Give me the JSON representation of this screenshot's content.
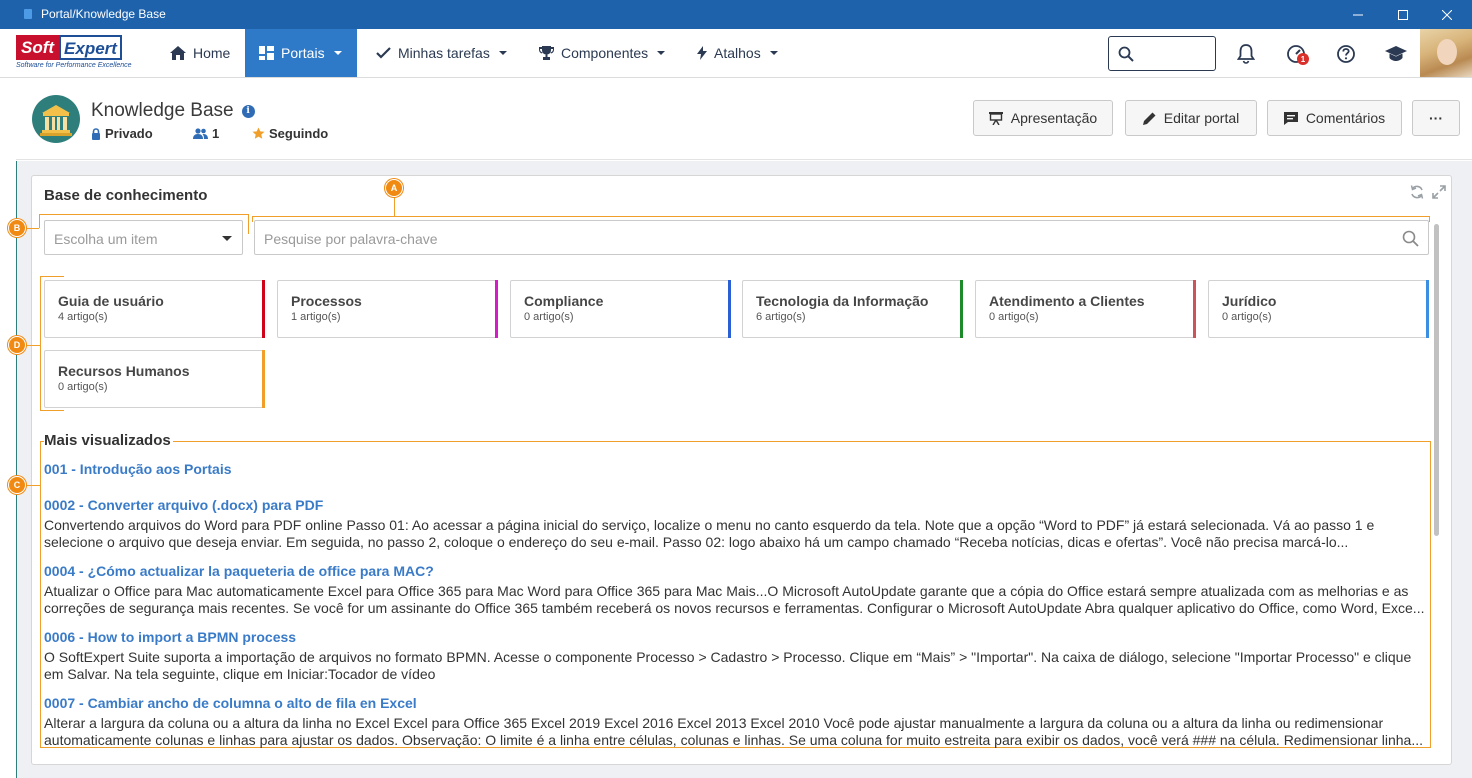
{
  "window": {
    "title": "Portal/Knowledge Base"
  },
  "brand": {
    "logo_left": "Soft",
    "logo_right": "Expert",
    "tagline": "Software for Performance Excellence",
    "accent": "#2f7ac8",
    "titlebar": "#1e62ac"
  },
  "nav": {
    "items": [
      {
        "label": "Home",
        "icon": "home-icon"
      },
      {
        "label": "Portais",
        "icon": "dashboard-icon"
      },
      {
        "label": "Minhas tarefas",
        "icon": "check-icon"
      },
      {
        "label": "Componentes",
        "icon": "trophy-icon"
      },
      {
        "label": "Atalhos",
        "icon": "bolt-icon"
      }
    ],
    "notification_count": "1"
  },
  "header": {
    "title": "Knowledge Base",
    "privacy": "Privado",
    "members": "1",
    "following": "Seguindo",
    "buttons": {
      "presentation": "Apresentação",
      "edit": "Editar portal",
      "comments": "Comentários",
      "more": "···"
    }
  },
  "panel": {
    "title": "Base de conhecimento",
    "select_placeholder": "Escolha um item",
    "search_placeholder": "Pesquise por palavra-chave"
  },
  "categories": [
    {
      "name": "Guia de usuário",
      "count": "4 artigo(s)",
      "color": "#d0021b"
    },
    {
      "name": "Processos",
      "count": "1 artigo(s)",
      "color": "#d61cc4"
    },
    {
      "name": "Compliance",
      "count": "0 artigo(s)",
      "color": "#2a5fd6"
    },
    {
      "name": "Tecnologia da Informação",
      "count": "6 artigo(s)",
      "color": "#1d8a2a"
    },
    {
      "name": "Atendimento a Clientes",
      "count": "0 artigo(s)",
      "color": "#c9545a"
    },
    {
      "name": "Jurídico",
      "count": "0 artigo(s)",
      "color": "#3a8fe0"
    },
    {
      "name": "Recursos Humanos",
      "count": "0 artigo(s)",
      "color": "#f0a02a"
    }
  ],
  "most_viewed": {
    "title": "Mais visualizados",
    "articles": [
      {
        "title": "001 - Introdução aos Portais",
        "text": ""
      },
      {
        "title": "0002 - Converter arquivo (.docx) para PDF",
        "text": "Convertendo arquivos do Word para PDF online Passo 01: Ao acessar a página inicial do serviço, localize o menu no canto esquerdo da tela. Note que a opção “Word to PDF” já estará selecionada. Vá ao passo 1 e selecione o arquivo que deseja enviar. Em seguida, no passo 2, coloque o endereço do seu e-mail. Passo 02: logo abaixo há um campo chamado “Receba notícias, dicas e ofertas”. Você não precisa marcá-lo..."
      },
      {
        "title": "0004 - ¿Cómo actualizar la paqueteria de office para MAC?",
        "text": "Atualizar o Office para Mac automaticamente Excel para Office 365 para Mac Word para Office 365 para Mac Mais...O Microsoft AutoUpdate garante que a cópia do Office estará sempre atualizada com as melhorias e as correções de segurança mais recentes. Se você for um assinante do Office 365 também receberá os novos recursos e ferramentas. Configurar o Microsoft AutoUpdate Abra qualquer aplicativo do Office, como Word, Exce..."
      },
      {
        "title": "0006 - How to import a BPMN process",
        "text": "O SoftExpert Suite suporta a importação de arquivos no formato BPMN. Acesse o componente Processo > Cadastro > Processo. Clique em “Mais” > \"Importar\". Na caixa de diálogo, selecione \"Importar Processo\" e clique em Salvar. Na tela seguinte, clique em Iniciar:Tocador de vídeo"
      },
      {
        "title": "0007 - Cambiar ancho de columna o alto de fila en Excel",
        "text": "Alterar a largura da coluna ou a altura da linha no Excel Excel para Office 365 Excel 2019 Excel 2016 Excel 2013 Excel 2010 Você pode ajustar manualmente a largura da coluna ou a altura da linha ou redimensionar automaticamente colunas e linhas para ajustar os dados. Observação: O limite é a linha entre células, colunas e linhas. Se uma coluna for muito estreita para exibir os dados, você verá ### na célula. Redimensionar linha..."
      }
    ]
  },
  "callouts": [
    "A",
    "B",
    "D",
    "C"
  ]
}
